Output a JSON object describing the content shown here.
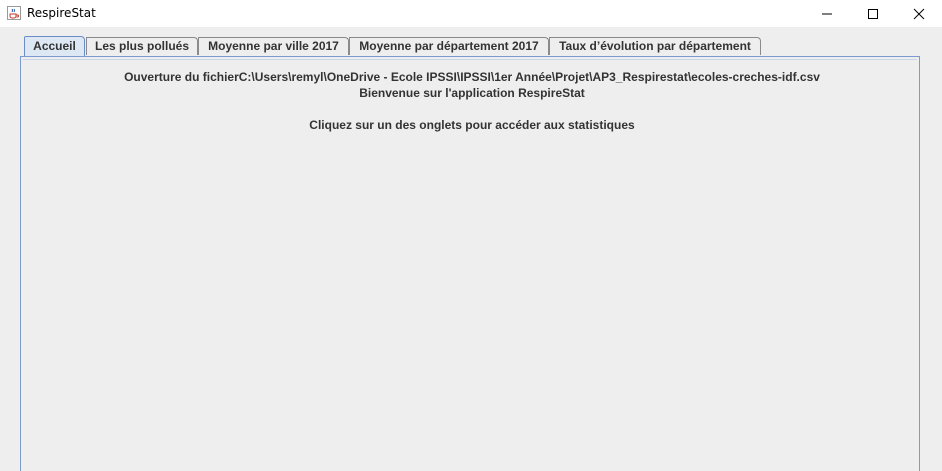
{
  "window": {
    "title": "RespireStat",
    "icon": "java-cup-icon"
  },
  "tabs": [
    {
      "label": "Accueil",
      "active": true
    },
    {
      "label": "Les plus pollués",
      "active": false
    },
    {
      "label": "Moyenne par ville 2017",
      "active": false
    },
    {
      "label": "Moyenne par département 2017",
      "active": false
    },
    {
      "label": "Taux d’évolution par département",
      "active": false
    }
  ],
  "home": {
    "file_message": "Ouverture du fichierC:\\Users\\remyl\\OneDrive - Ecole IPSSI\\IPSSI\\1er Année\\Projet\\AP3_Respirestat\\ecoles-creches-idf.csv",
    "welcome": "Bienvenue sur l'application RespireStat",
    "instruction": "Cliquez sur un des onglets pour accéder aux statistiques"
  },
  "colors": {
    "active_tab_bg": "#dde8f4",
    "active_tab_border": "#6a8cc8",
    "panel_border": "#7a9ad0",
    "background": "#eeeeee"
  }
}
